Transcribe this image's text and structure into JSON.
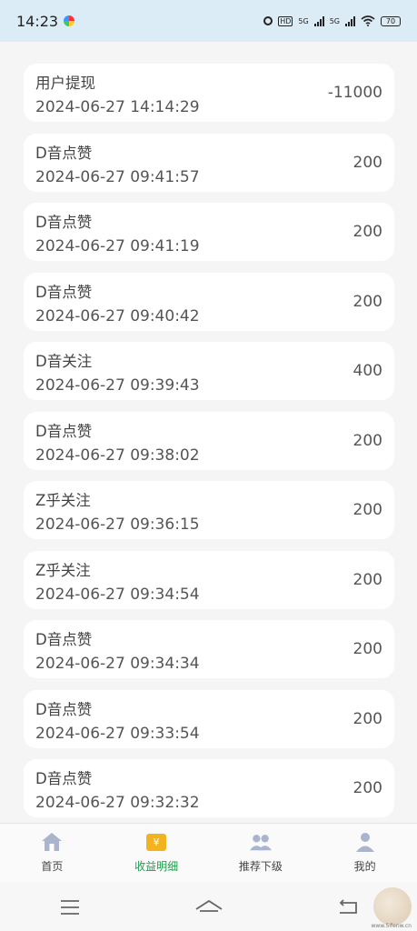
{
  "status": {
    "time": "14:23",
    "network1": "5G",
    "network2": "5G",
    "hd": "HD",
    "battery": "70"
  },
  "records": [
    {
      "title": "用户提现",
      "time": "2024-06-27 14:14:29",
      "amount": "-11000"
    },
    {
      "title": "D音点赞",
      "time": "2024-06-27 09:41:57",
      "amount": "200"
    },
    {
      "title": "D音点赞",
      "time": "2024-06-27 09:41:19",
      "amount": "200"
    },
    {
      "title": "D音点赞",
      "time": "2024-06-27 09:40:42",
      "amount": "200"
    },
    {
      "title": "D音关注",
      "time": "2024-06-27 09:39:43",
      "amount": "400"
    },
    {
      "title": "D音点赞",
      "time": "2024-06-27 09:38:02",
      "amount": "200"
    },
    {
      "title": "Z乎关注",
      "time": "2024-06-27 09:36:15",
      "amount": "200"
    },
    {
      "title": "Z乎关注",
      "time": "2024-06-27 09:34:54",
      "amount": "200"
    },
    {
      "title": "D音点赞",
      "time": "2024-06-27 09:34:34",
      "amount": "200"
    },
    {
      "title": "D音点赞",
      "time": "2024-06-27 09:33:54",
      "amount": "200"
    },
    {
      "title": "D音点赞",
      "time": "2024-06-27 09:32:32",
      "amount": "200"
    }
  ],
  "tabs": [
    {
      "label": "首页",
      "icon": "home-icon"
    },
    {
      "label": "收益明细",
      "icon": "wallet-icon",
      "active": true
    },
    {
      "label": "推荐下级",
      "icon": "users-icon"
    },
    {
      "label": "我的",
      "icon": "user-icon"
    }
  ],
  "colors": {
    "statusbar": "#dcecf7",
    "active_tab": "#1a9e4a",
    "active_icon": "#f2b31e",
    "inactive_icon": "#aab4cc"
  },
  "watermark": {
    "text": "www.5ifenw.cn"
  }
}
